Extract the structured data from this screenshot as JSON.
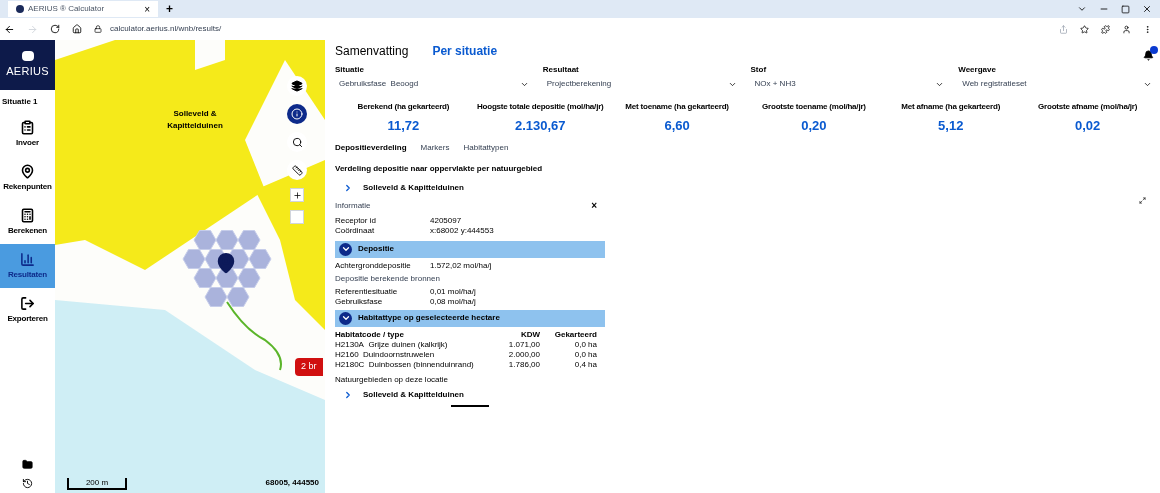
{
  "browser": {
    "tab_title": "AERIUS ® Calculator",
    "tab_close": "×",
    "new_tab": "+",
    "url": "calculator.aerius.nl/wnb/results/"
  },
  "sidebar": {
    "logo": "AERIUS",
    "situation": "Situatie 1",
    "items": [
      {
        "label": "Invoer",
        "selected": false
      },
      {
        "label": "Rekenpunten",
        "selected": false
      },
      {
        "label": "Berekenen",
        "selected": false
      },
      {
        "label": "Resultaten",
        "selected": true
      },
      {
        "label": "Exporteren",
        "selected": false
      }
    ]
  },
  "map": {
    "area_label": "Solleveld & Kapittelduinen",
    "badge": "2 br",
    "scale": "200 m",
    "coordinates": "68005, 444550"
  },
  "tabs": [
    {
      "label": "Samenvatting",
      "selected": false
    },
    {
      "label": "Per situatie",
      "selected": true
    }
  ],
  "selects": [
    {
      "label": "Situatie",
      "value": "Gebruiksfase  Beoogd"
    },
    {
      "label": "Resultaat",
      "value": "Projectberekening"
    },
    {
      "label": "Stof",
      "value": "NOx + NH3"
    },
    {
      "label": "Weergave",
      "value": "Web registratieset"
    }
  ],
  "stats": [
    {
      "label": "Berekend (ha gekarteerd)",
      "value": "11,72"
    },
    {
      "label": "Hoogste totale depositie (mol/ha/jr)",
      "value": "2.130,67"
    },
    {
      "label": "Met toename (ha gekarteerd)",
      "value": "6,60"
    },
    {
      "label": "Grootste toename (mol/ha/jr)",
      "value": "0,20"
    },
    {
      "label": "Met afname (ha gekarteerd)",
      "value": "5,12"
    },
    {
      "label": "Grootste afname (mol/ha/jr)",
      "value": "0,02"
    }
  ],
  "sub_tabs": [
    {
      "label": "Depositieverdeling",
      "selected": true
    },
    {
      "label": "Markers",
      "selected": false
    },
    {
      "label": "Habitattypen",
      "selected": false
    }
  ],
  "distribution": {
    "title": "Verdeling depositie naar oppervlakte per natuurgebied",
    "areas": [
      {
        "label": "Solleveld & Kapittelduinen",
        "expanded": false
      }
    ]
  },
  "info": {
    "title": "Informatie",
    "close": "×",
    "fields": [
      {
        "label": "Receptor id",
        "value": "4205097"
      },
      {
        "label": "Coördinaat",
        "value": "x:68002 y:444553"
      }
    ],
    "deposition": {
      "title": "Depositie",
      "expanded": true,
      "background_label": "Achtergronddepositie",
      "background_value": "1.572,02 mol/ha/j",
      "sources_title": "Depositie berekende bronnen",
      "rows": [
        {
          "label": "Referentiesituatie",
          "value": "0,01 mol/ha/j"
        },
        {
          "label": "Gebruiksfase",
          "value": "0,08 mol/ha/j"
        }
      ]
    },
    "habitat": {
      "title": "Habitattype op geselecteerde hectare",
      "expanded": true,
      "columns": [
        "Habitatcode / type",
        "KDW",
        "Gekarteerd"
      ],
      "rows": [
        {
          "code": "H2130A",
          "name": "Grijze duinen (kalkrijk)",
          "kdw": "1.071,00",
          "mapped": "0,0 ha"
        },
        {
          "code": "H2160",
          "name": "Duindoornstruwelen",
          "kdw": "2.000,00",
          "mapped": "0,0 ha"
        },
        {
          "code": "H2180C",
          "name": "Duinbossen (binnenduinrand)",
          "kdw": "1.786,00",
          "mapped": "0,4 ha"
        }
      ]
    },
    "nature_title": "Natuurgebieden op deze locatie",
    "nature_areas": [
      {
        "label": "Solleveld & Kapittelduinen",
        "expanded": false
      }
    ]
  }
}
